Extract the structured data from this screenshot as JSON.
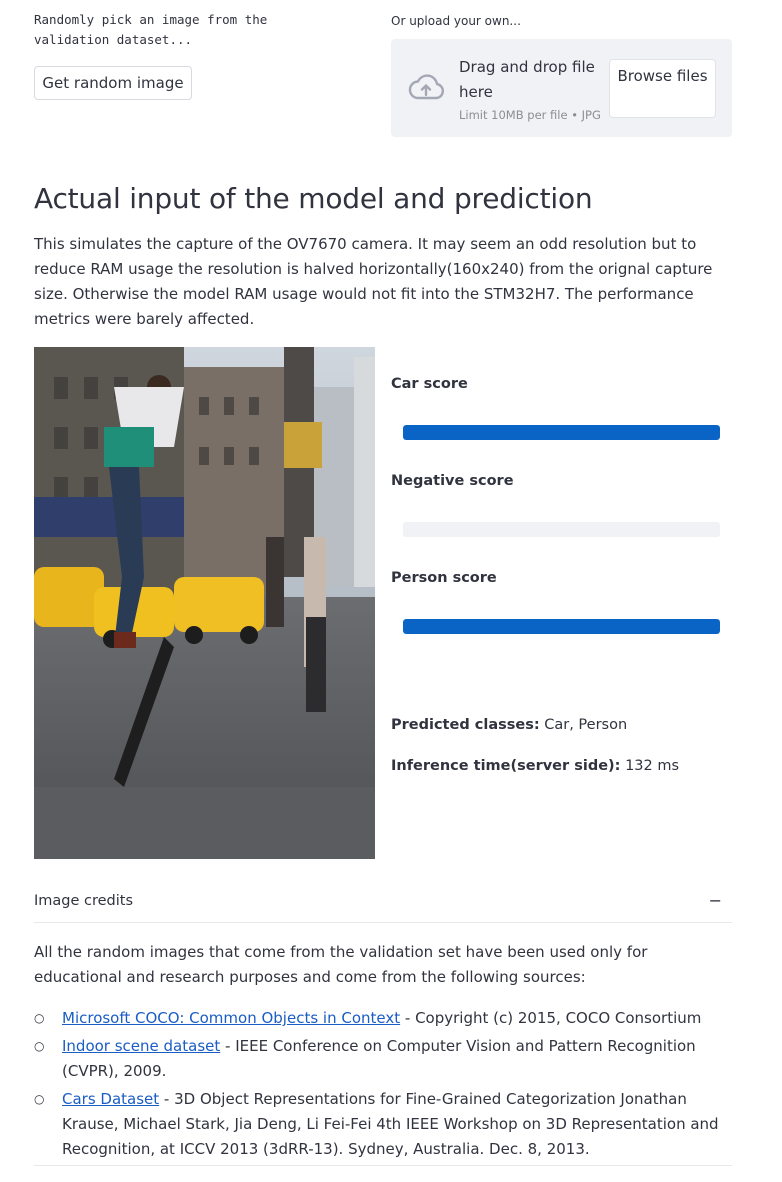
{
  "random": {
    "description": "Randomly pick an image from the\nvalidation dataset...",
    "button_label": "Get random image"
  },
  "upload": {
    "label": "Or upload your own...",
    "drop_text": "Drag and drop file here",
    "limit_text": "Limit 10MB per file • JPG",
    "browse_label": "Browse files",
    "icon": "cloud-upload-icon"
  },
  "section": {
    "title": "Actual input of the model and prediction",
    "intro": "This simulates the capture of the OV7670 camera. It may seem an odd resolution but to reduce RAM usage the resolution is halved horizontally(160x240) from the orignal capture size. Otherwise the model RAM usage would not fit into the STM32H7. The performance metrics were barely affected."
  },
  "scores": [
    {
      "label": "Car score",
      "value": 1.0
    },
    {
      "label": "Negative score",
      "value": 0.0
    },
    {
      "label": "Person score",
      "value": 1.0
    }
  ],
  "colors": {
    "bar": "#0964c6",
    "track": "#f0f2f6",
    "link": "#1a5dc4"
  },
  "results": {
    "predicted_label": "Predicted classes:",
    "predicted_value": " Car, Person",
    "inference_label": "Inference time(server side):",
    "inference_value": " 132 ms"
  },
  "credits": {
    "title": "Image credits",
    "collapse_icon": "−",
    "body": "All the random images that come from the validation set have been used only for educational and research purposes and come from the following sources:",
    "items": [
      {
        "link": "Microsoft COCO: Common Objects in Context",
        "text": " - Copyright (c) 2015, COCO Consortium"
      },
      {
        "link": "Indoor scene dataset",
        "text": " - IEEE Conference on Computer Vision and Pattern Recognition (CVPR), 2009."
      },
      {
        "link": "Cars Dataset",
        "text": " - 3D Object Representations for Fine-Grained Categorization Jonathan Krause, Michael Stark, Jia Deng, Li Fei-Fei 4th IEEE Workshop on 3D Representation and Recognition, at ICCV 2013 (3dRR-13). Sydney, Australia. Dec. 8, 2013."
      }
    ]
  }
}
